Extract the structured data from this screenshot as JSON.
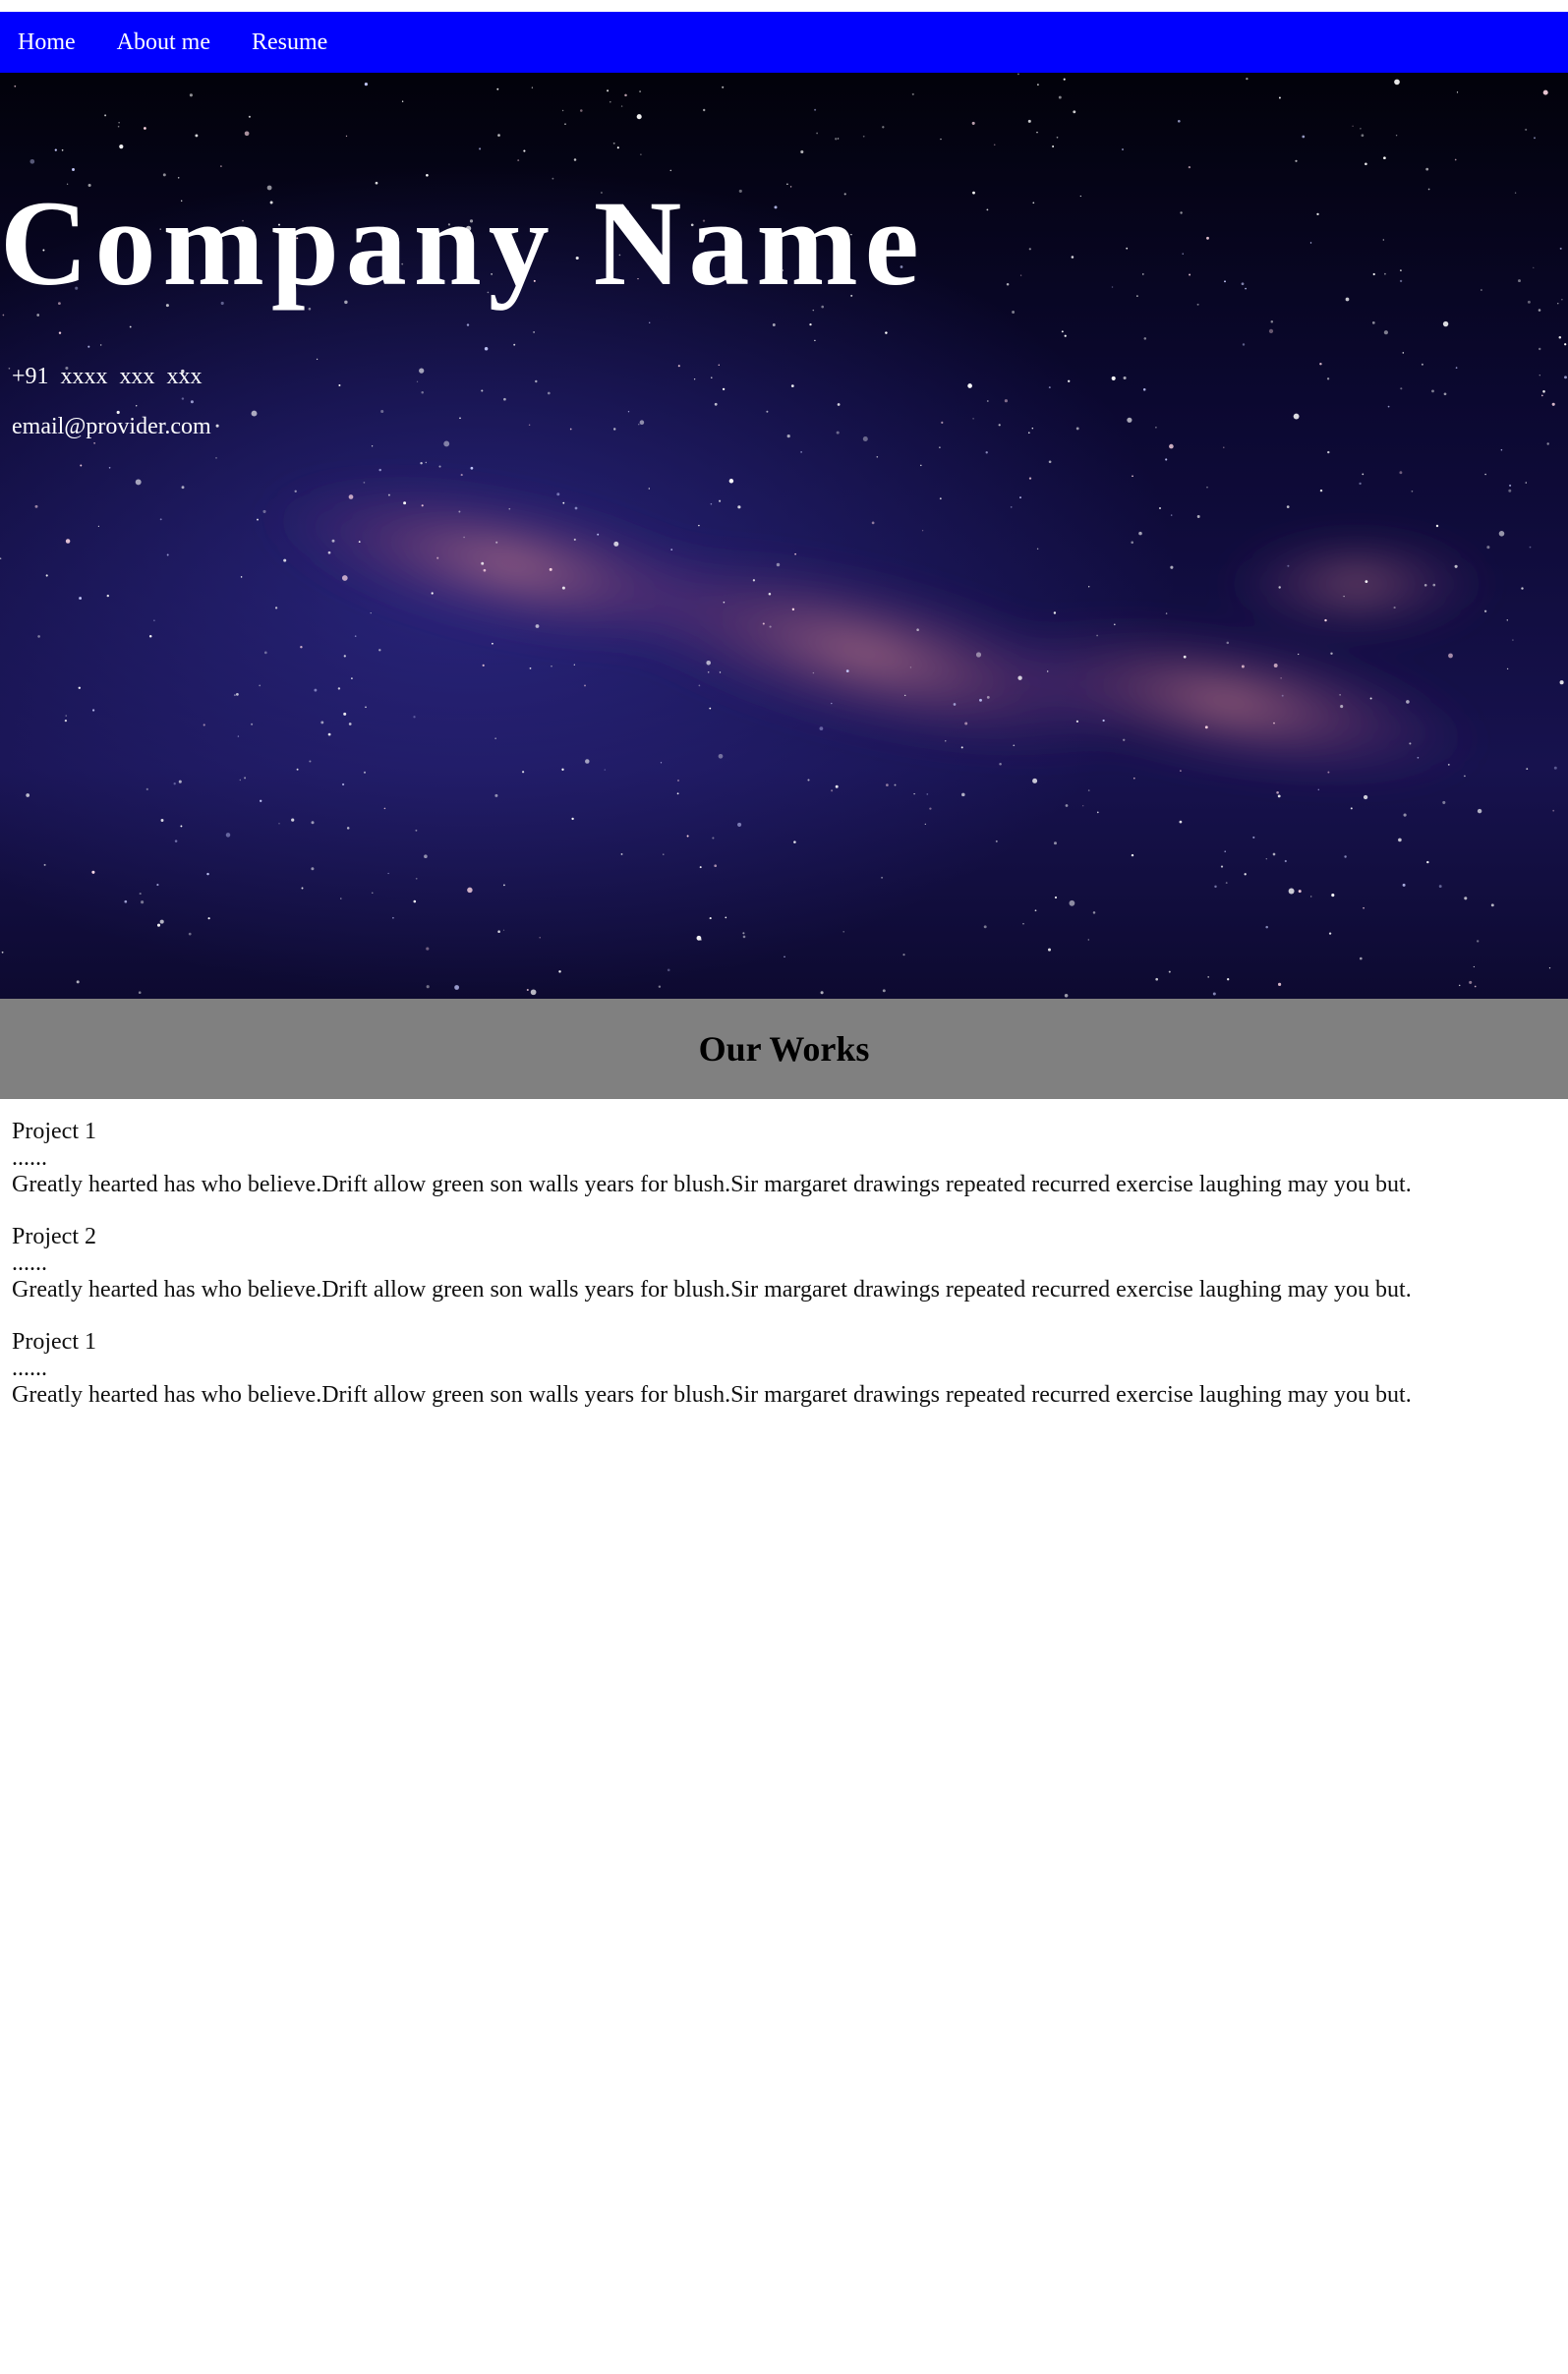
{
  "nav": {
    "items": [
      {
        "label": "Home"
      },
      {
        "label": "About me"
      },
      {
        "label": "Resume"
      }
    ]
  },
  "hero": {
    "title": "Company Name",
    "phone": "+91  xxxx  xxx  xxx",
    "email": "email@provider.com",
    "background": "starry-night-milky-way-image"
  },
  "works": {
    "title": "Our Works",
    "projects": [
      {
        "name": "Project 1",
        "dots": "......",
        "description": "Greatly hearted has who believe.Drift allow green son walls years for blush.Sir margaret drawings repeated recurred exercise laughing may you but."
      },
      {
        "name": "Project 2",
        "dots": "......",
        "description": "Greatly hearted has who believe.Drift allow green son walls years for blush.Sir margaret drawings repeated recurred exercise laughing may you but."
      },
      {
        "name": "Project 1",
        "dots": "......",
        "description": "Greatly hearted has who believe.Drift allow green son walls years for blush.Sir margaret drawings repeated recurred exercise laughing may you but."
      }
    ]
  },
  "colors": {
    "nav_bg": "#0000ff",
    "works_header_bg": "#808080",
    "hero_text": "#ffffff"
  }
}
